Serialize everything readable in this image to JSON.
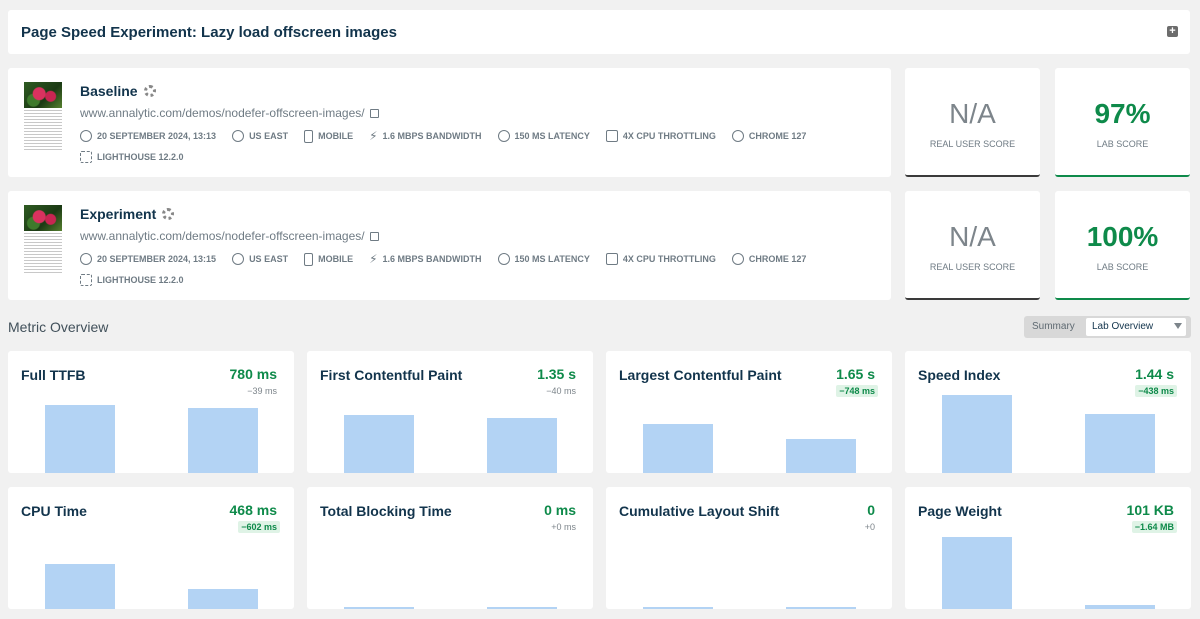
{
  "header": {
    "title": "Page Speed Experiment: Lazy load offscreen images"
  },
  "tests": [
    {
      "name": "Baseline",
      "url": "www.annalytic.com/demos/nodefer-offscreen-images/",
      "date": "20 SEPTEMBER 2024, 13:13",
      "location": "US EAST",
      "device": "MOBILE",
      "bandwidth": "1.6 MBPS BANDWIDTH",
      "latency": "150 MS LATENCY",
      "cpu": "4X CPU THROTTLING",
      "browser": "CHROME 127",
      "lighthouse": "LIGHTHOUSE 12.2.0",
      "real_user_score": "N/A",
      "real_user_label": "REAL USER SCORE",
      "lab_score": "97%",
      "lab_label": "LAB SCORE"
    },
    {
      "name": "Experiment",
      "url": "www.annalytic.com/demos/nodefer-offscreen-images/",
      "date": "20 SEPTEMBER 2024, 13:15",
      "location": "US EAST",
      "device": "MOBILE",
      "bandwidth": "1.6 MBPS BANDWIDTH",
      "latency": "150 MS LATENCY",
      "cpu": "4X CPU THROTTLING",
      "browser": "CHROME 127",
      "lighthouse": "LIGHTHOUSE 12.2.0",
      "real_user_score": "N/A",
      "real_user_label": "REAL USER SCORE",
      "lab_score": "100%",
      "lab_label": "LAB SCORE"
    }
  ],
  "overview": {
    "title": "Metric Overview",
    "toggle": {
      "summary": "Summary",
      "lab": "Lab Overview"
    }
  },
  "metrics": [
    {
      "name": "Full TTFB",
      "value": "780 ms",
      "delta": "−39 ms",
      "delta_good": false,
      "bars": [
        0.54,
        0.52
      ]
    },
    {
      "name": "First Contentful Paint",
      "value": "1.35 s",
      "delta": "−40 ms",
      "delta_good": false,
      "bars": [
        0.46,
        0.44
      ]
    },
    {
      "name": "Largest Contentful Paint",
      "value": "1.65 s",
      "delta": "−748 ms",
      "delta_good": true,
      "bars": [
        0.39,
        0.27
      ]
    },
    {
      "name": "Speed Index",
      "value": "1.44 s",
      "delta": "−438 ms",
      "delta_good": true,
      "bars": [
        0.62,
        0.47
      ]
    },
    {
      "name": "CPU Time",
      "value": "468 ms",
      "delta": "−602 ms",
      "delta_good": true,
      "bars": [
        0.36,
        0.16
      ]
    },
    {
      "name": "Total Blocking Time",
      "value": "0 ms",
      "delta": "+0 ms",
      "delta_good": false,
      "bars": [
        0.01,
        0.01
      ]
    },
    {
      "name": "Cumulative Layout Shift",
      "value": "0",
      "delta": "+0",
      "delta_good": false,
      "bars": [
        0.01,
        0.01
      ]
    },
    {
      "name": "Page Weight",
      "value": "101 KB",
      "delta": "−1.64 MB",
      "delta_good": true,
      "bars": [
        0.57,
        0.03
      ]
    }
  ]
}
